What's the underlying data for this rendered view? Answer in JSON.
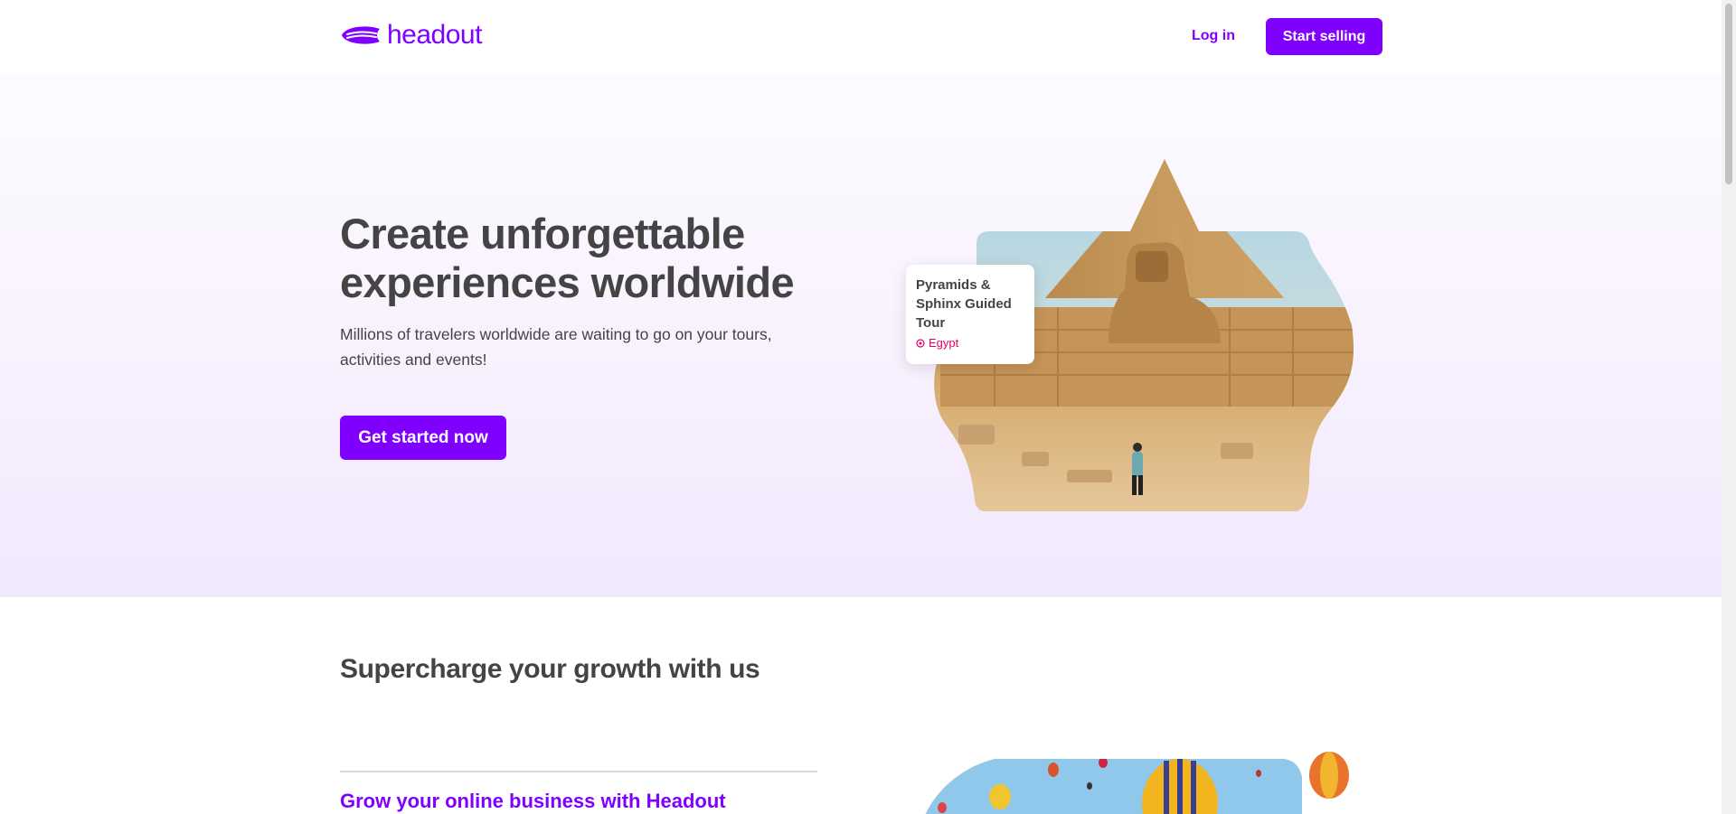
{
  "header": {
    "logo_text": "headout",
    "login_label": "Log in",
    "start_selling_label": "Start selling"
  },
  "hero": {
    "title": "Create unforgettable experiences worldwide",
    "subtitle": "Millions of travelers worldwide are waiting to go on your tours, activities and events!",
    "cta_label": "Get started now",
    "tour_card": {
      "title": "Pyramids & Sphinx Guided Tour",
      "location": "Egypt"
    }
  },
  "growth": {
    "section_title": "Supercharge your growth with us",
    "item_title": "Grow your online business with Headout"
  },
  "colors": {
    "brand_purple": "#8000ff",
    "location_pink": "#e5006a",
    "text_dark": "#444444"
  },
  "icons": {
    "logo": "blimp-logo-icon",
    "location": "location-pin-icon"
  }
}
